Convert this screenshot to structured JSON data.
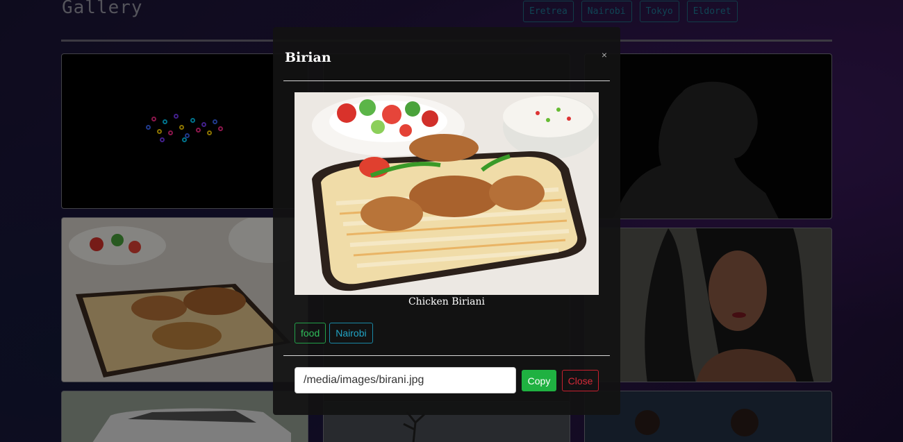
{
  "page": {
    "title": "Gallery",
    "filters": [
      "Eretrea",
      "Nairobi",
      "Tokyo",
      "Eldoret"
    ]
  },
  "gallery": {
    "cards": [
      {
        "image": "abstract-dots"
      },
      {
        "image": "dark-tiles"
      },
      {
        "image": "man-silhouette"
      },
      {
        "image": "biryani"
      },
      {
        "image": "dark-interior"
      },
      {
        "image": "woman-portrait"
      },
      {
        "image": "white-suv"
      },
      {
        "image": "bare-tree"
      },
      {
        "image": "children"
      }
    ]
  },
  "modal": {
    "title": "Birian",
    "close_icon": "×",
    "caption": "Chicken Biriani",
    "tags": [
      "food",
      "Nairobi"
    ],
    "image_path": "/media/images/birani.jpg",
    "copy_label": "Copy",
    "close_label": "Close"
  },
  "colors": {
    "filter_accent": "#1e7d99",
    "tag_food": "#2fbf5a",
    "tag_location": "#21a5c6",
    "copy_button": "#1fb141",
    "close_button": "#d42a38"
  }
}
